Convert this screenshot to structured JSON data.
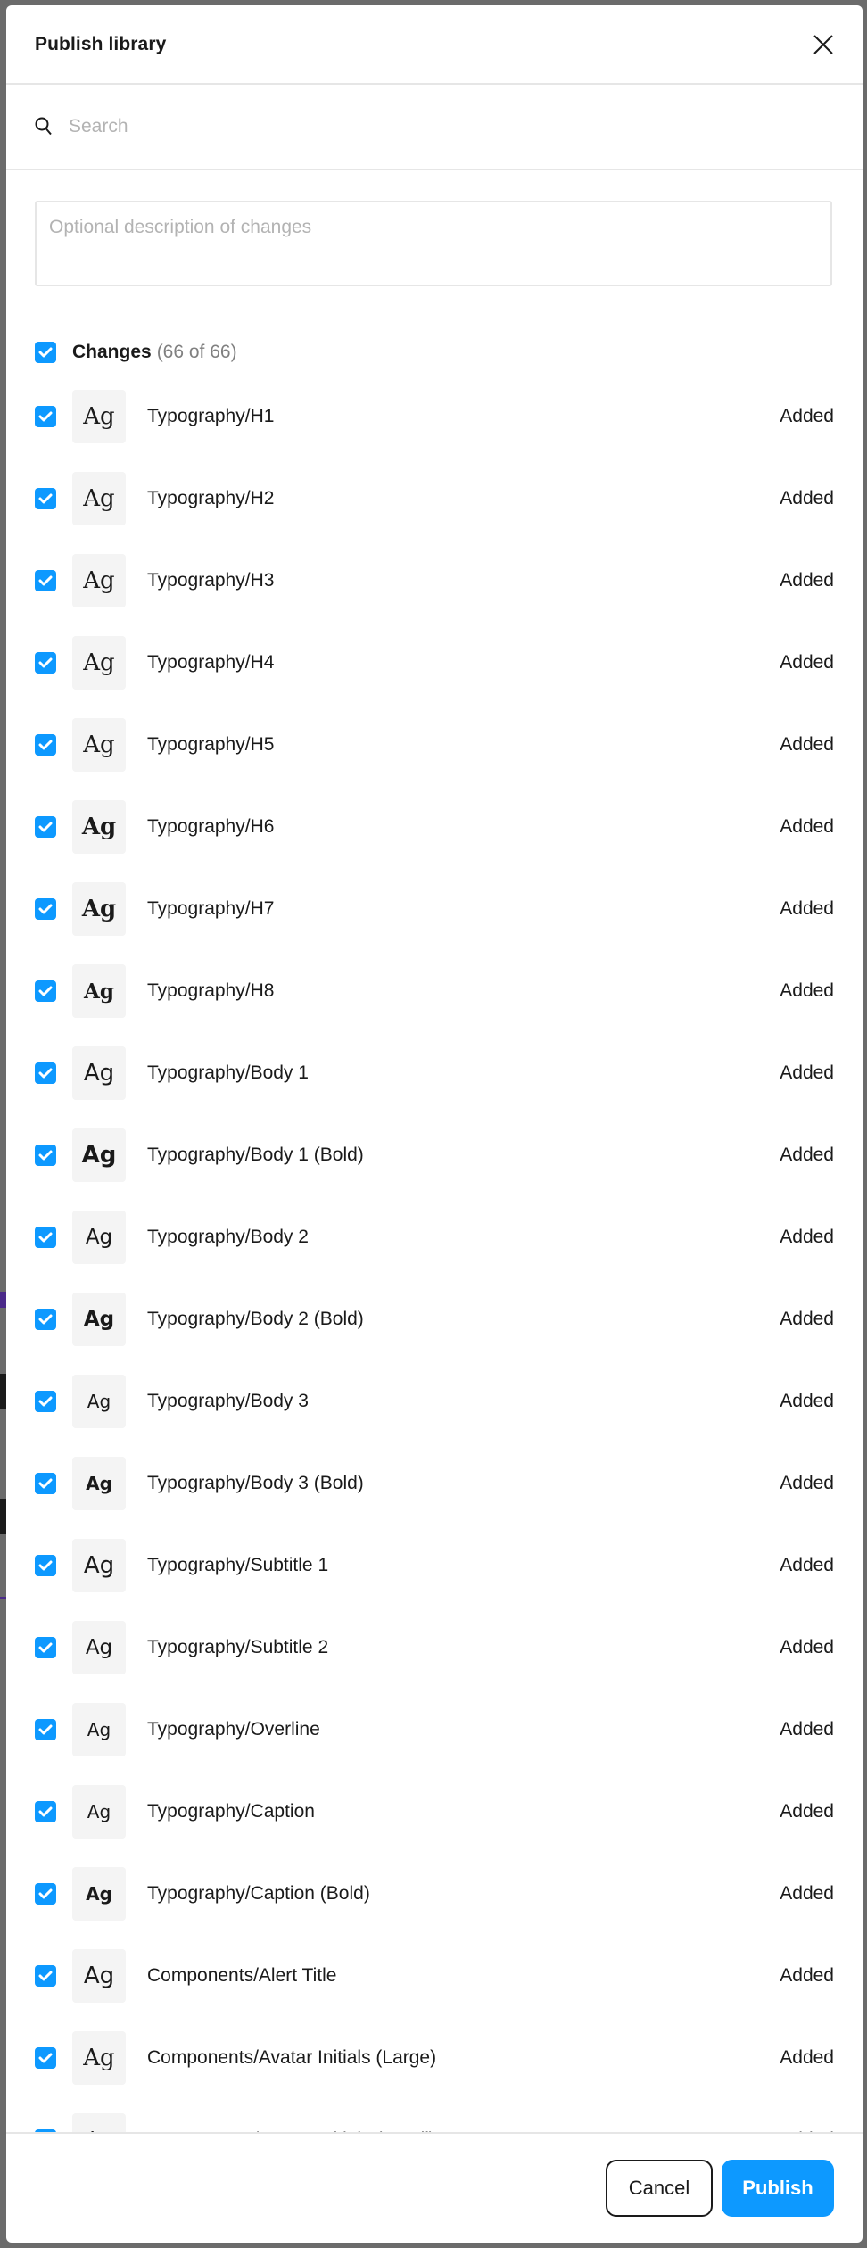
{
  "dialog": {
    "title": "Publish library",
    "close_icon": "close-icon"
  },
  "search": {
    "icon": "search-icon",
    "placeholder": "Search",
    "value": ""
  },
  "description": {
    "placeholder": "Optional description of changes",
    "value": ""
  },
  "changes": {
    "label": "Changes",
    "count": "(66 of 66)",
    "checked": true,
    "items": [
      {
        "name": "Typography/H1",
        "status": "Added",
        "preview": "Ag",
        "style": "serif",
        "weight": "normal",
        "size": "l",
        "checked": true
      },
      {
        "name": "Typography/H2",
        "status": "Added",
        "preview": "Ag",
        "style": "serif",
        "weight": "normal",
        "size": "l",
        "checked": true
      },
      {
        "name": "Typography/H3",
        "status": "Added",
        "preview": "Ag",
        "style": "serif",
        "weight": "normal",
        "size": "l",
        "checked": true
      },
      {
        "name": "Typography/H4",
        "status": "Added",
        "preview": "Ag",
        "style": "serif",
        "weight": "normal",
        "size": "l",
        "checked": true
      },
      {
        "name": "Typography/H5",
        "status": "Added",
        "preview": "Ag",
        "style": "serif",
        "weight": "normal",
        "size": "l",
        "checked": true
      },
      {
        "name": "Typography/H6",
        "status": "Added",
        "preview": "Ag",
        "style": "serif",
        "weight": "bold",
        "size": "l",
        "checked": true
      },
      {
        "name": "Typography/H7",
        "status": "Added",
        "preview": "Ag",
        "style": "serif",
        "weight": "bold",
        "size": "l",
        "checked": true
      },
      {
        "name": "Typography/H8",
        "status": "Added",
        "preview": "Ag",
        "style": "serif",
        "weight": "bold",
        "size": "m",
        "checked": true
      },
      {
        "name": "Typography/Body 1",
        "status": "Added",
        "preview": "Ag",
        "style": "sans",
        "weight": "normal",
        "size": "l",
        "checked": true
      },
      {
        "name": "Typography/Body 1 (Bold)",
        "status": "Added",
        "preview": "Ag",
        "style": "sans",
        "weight": "bold",
        "size": "l",
        "checked": true
      },
      {
        "name": "Typography/Body 2",
        "status": "Added",
        "preview": "Ag",
        "style": "sans",
        "weight": "normal",
        "size": "m",
        "checked": true
      },
      {
        "name": "Typography/Body 2 (Bold)",
        "status": "Added",
        "preview": "Ag",
        "style": "sans",
        "weight": "bold",
        "size": "m",
        "checked": true
      },
      {
        "name": "Typography/Body 3",
        "status": "Added",
        "preview": "Ag",
        "style": "sans",
        "weight": "normal",
        "size": "s",
        "checked": true
      },
      {
        "name": "Typography/Body 3 (Bold)",
        "status": "Added",
        "preview": "Ag",
        "style": "sans",
        "weight": "bold",
        "size": "s",
        "checked": true
      },
      {
        "name": "Typography/Subtitle 1",
        "status": "Added",
        "preview": "Ag",
        "style": "sans",
        "weight": "normal",
        "size": "l",
        "checked": true
      },
      {
        "name": "Typography/Subtitle 2",
        "status": "Added",
        "preview": "Ag",
        "style": "sans",
        "weight": "normal",
        "size": "m",
        "checked": true
      },
      {
        "name": "Typography/Overline",
        "status": "Added",
        "preview": "Ag",
        "style": "sans",
        "weight": "normal",
        "size": "s",
        "checked": true
      },
      {
        "name": "Typography/Caption",
        "status": "Added",
        "preview": "Ag",
        "style": "sans",
        "weight": "normal",
        "size": "s",
        "checked": true
      },
      {
        "name": "Typography/Caption (Bold)",
        "status": "Added",
        "preview": "Ag",
        "style": "sans",
        "weight": "heavy",
        "size": "s",
        "checked": true
      },
      {
        "name": "Components/Alert Title",
        "status": "Added",
        "preview": "Ag",
        "style": "sans",
        "weight": "normal",
        "size": "l",
        "checked": true
      },
      {
        "name": "Components/Avatar Initials (Large)",
        "status": "Added",
        "preview": "Ag",
        "style": "serif",
        "weight": "normal",
        "size": "l",
        "checked": true
      },
      {
        "name": "Components/Avatar Initials (Small)",
        "status": "Added",
        "preview": "Ag",
        "style": "serif",
        "weight": "normal",
        "size": "m",
        "checked": true
      }
    ]
  },
  "footer": {
    "cancel_label": "Cancel",
    "publish_label": "Publish"
  },
  "colors": {
    "accent": "#0d99ff",
    "overlay": "#6b6b6b",
    "divider": "#e6e6e6"
  }
}
